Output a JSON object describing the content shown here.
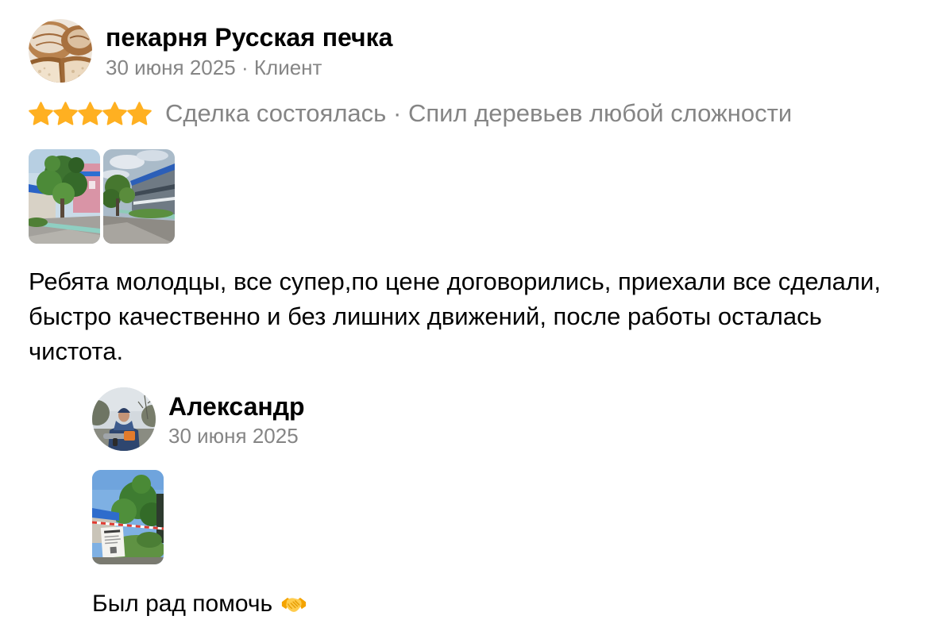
{
  "colors": {
    "text_primary": "#000000",
    "text_secondary": "#858585",
    "star": "#FFB021",
    "background": "#FFFFFF"
  },
  "icons": {
    "star": "star-icon",
    "reply_emoji": "handshake-icon"
  },
  "review": {
    "author": {
      "name": "пекарня Русская печка",
      "date": "30 июня 2025",
      "separator": "·",
      "role": "Клиент"
    },
    "rating": 5,
    "rating_max": 5,
    "deal": {
      "status": "Сделка состоялась",
      "separator": "·",
      "service": "Спил деревьев любой сложности"
    },
    "text": "Ребята молодцы, все супер,по цене договорились, приехали все сделали, быстро качественно и без лишних движений, после работы осталась чистота."
  },
  "reply": {
    "author": {
      "name": "Александр",
      "date": "30 июня 2025"
    },
    "text": "Был рад помочь"
  }
}
